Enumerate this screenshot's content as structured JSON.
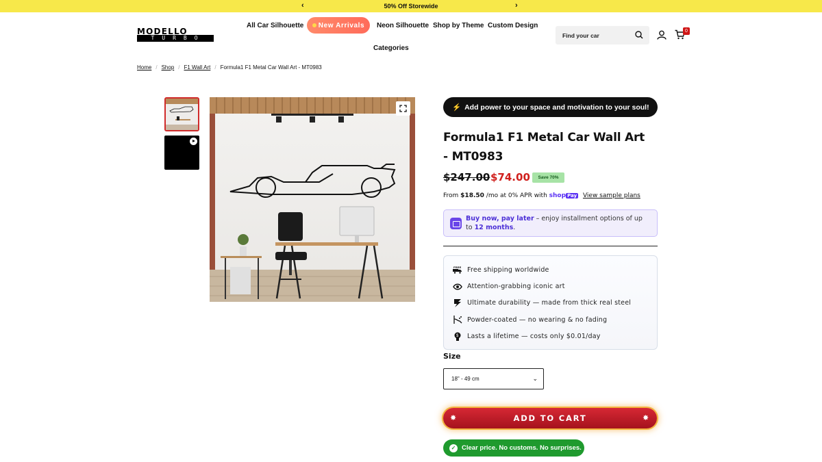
{
  "announcement": {
    "text": "50% Off Storewide",
    "prev": "‹",
    "next": "›"
  },
  "brand": {
    "logo_top": "MODELLO",
    "logo_bottom": "TURBO"
  },
  "nav": {
    "items": [
      "All Car Silhouette",
      "New Arrivals",
      "Neon Silhouette",
      "Shop by Theme",
      "Custom Design",
      "Categories"
    ]
  },
  "search": {
    "placeholder": "Find your car"
  },
  "cart": {
    "count": "0"
  },
  "breadcrumb": {
    "items": [
      "Home",
      "Shop",
      "F1 Wall Art",
      "Formula1 F1 Metal Car Wall Art - MT0983"
    ]
  },
  "product": {
    "promo": "Add power to your space and motivation to your soul!",
    "promo_icon": "lightning-icon",
    "title": "Formula1 F1 Metal Car Wall Art - MT0983",
    "price_old": "$247.00",
    "price_new": "$74.00",
    "save_badge": "Save 70%",
    "apr": {
      "prefix": "From ",
      "amount": "$18.50",
      "suffix": "/mo at 0% APR with",
      "provider": "shop",
      "provider_pay": "Pay",
      "link": "View sample plans"
    },
    "bnpl": {
      "highlight": "Buy now, pay later",
      "text": " – enjoy installment options of up to ",
      "months": "12 months",
      "end": "."
    },
    "features": [
      {
        "icon": "free-shipping-icon",
        "text": "Free shipping worldwide"
      },
      {
        "icon": "eye-icon",
        "text": "Attention-grabbing iconic art"
      },
      {
        "icon": "steel-icon",
        "text": "Ultimate durability — made from thick real steel"
      },
      {
        "icon": "spray-icon",
        "text": "Powder-coated — no wearing & no fading"
      },
      {
        "icon": "coin-icon",
        "text": "Lasts a lifetime — costs only $0.01/day"
      }
    ],
    "size": {
      "label": "Size",
      "selected": "18\" - 49 cm"
    },
    "add_to_cart": "ADD TO CART",
    "clear_price": "Clear price. No customs. No surprises."
  },
  "colors": {
    "announcement_bg": "#f7e84a",
    "accent_red": "#d0201d",
    "shoppay_purple": "#5a31f4",
    "green": "#1f9a2e"
  }
}
